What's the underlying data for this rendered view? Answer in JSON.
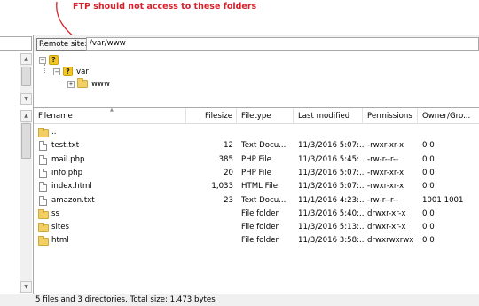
{
  "annotation": {
    "text": "FTP should not access to these folders",
    "color": "#d9202a"
  },
  "remote": {
    "label": "Remote site:",
    "path": "/var/www"
  },
  "tree": {
    "root": {
      "label": ""
    },
    "var": {
      "label": "var"
    },
    "www": {
      "label": "www"
    }
  },
  "list": {
    "headers": {
      "filename": "Filename",
      "filesize": "Filesize",
      "filetype": "Filetype",
      "last_modified": "Last modified",
      "permissions": "Permissions",
      "owner": "Owner/Gro..."
    },
    "rows": [
      {
        "name": "..",
        "size": "",
        "type": "",
        "modified": "",
        "perms": "",
        "owner": "",
        "icon": "folder-icon"
      },
      {
        "name": "test.txt",
        "size": "12",
        "type": "Text Docu...",
        "modified": "11/3/2016 5:07:...",
        "perms": "-rwxr-xr-x",
        "owner": "0 0",
        "icon": "file-icon"
      },
      {
        "name": "mail.php",
        "size": "385",
        "type": "PHP File",
        "modified": "11/3/2016 5:45:...",
        "perms": "-rw-r--r--",
        "owner": "0 0",
        "icon": "file-icon"
      },
      {
        "name": "info.php",
        "size": "20",
        "type": "PHP File",
        "modified": "11/3/2016 5:07:...",
        "perms": "-rwxr-xr-x",
        "owner": "0 0",
        "icon": "file-icon"
      },
      {
        "name": "index.html",
        "size": "1,033",
        "type": "HTML File",
        "modified": "11/3/2016 5:07:...",
        "perms": "-rwxr-xr-x",
        "owner": "0 0",
        "icon": "file-icon"
      },
      {
        "name": "amazon.txt",
        "size": "23",
        "type": "Text Docu...",
        "modified": "11/1/2016 4:23:...",
        "perms": "-rw-r--r--",
        "owner": "1001 1001",
        "icon": "file-icon"
      },
      {
        "name": "ss",
        "size": "",
        "type": "File folder",
        "modified": "11/3/2016 5:40:...",
        "perms": "drwxr-xr-x",
        "owner": "0 0",
        "icon": "folder-icon"
      },
      {
        "name": "sites",
        "size": "",
        "type": "File folder",
        "modified": "11/3/2016 5:13:...",
        "perms": "drwxr-xr-x",
        "owner": "0 0",
        "icon": "folder-icon"
      },
      {
        "name": "html",
        "size": "",
        "type": "File folder",
        "modified": "11/3/2016 3:58:...",
        "perms": "drwxrwxrwx",
        "owner": "0 0",
        "icon": "folder-icon"
      }
    ]
  },
  "status": {
    "text": "5 files and 3 directories. Total size: 1,473 bytes"
  }
}
